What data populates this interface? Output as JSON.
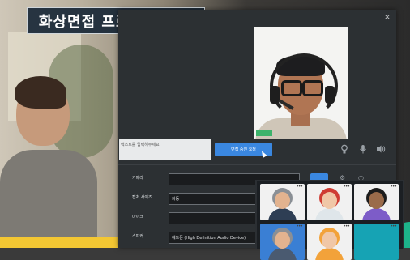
{
  "title": "화상면접 프로그램 접속",
  "dialog": {
    "close_glyph": "×",
    "message_placeholder": "텍스트를 입력해주세요.",
    "send_button": "면접 승인 요청",
    "controls": [
      "camera-icon",
      "microphone-icon",
      "speaker-icon"
    ],
    "settings": {
      "camera_label": "카메라",
      "camera_value": "",
      "resolution_label": "캡처 사이즈",
      "resolution_value": "자동",
      "mic_label": "마이크",
      "mic_value": "",
      "speaker_label": "스피커",
      "speaker_value": "헤드폰 (High Definition Audio Device)"
    }
  },
  "colors": {
    "accent": "#3a87e0",
    "dialog_bg": "#2c3033",
    "title_bg": "#192837",
    "floor": "#f3c733",
    "badge": "#1db38b"
  },
  "participants": [
    {
      "name": "participant-man-suit",
      "bg": "#f1f1f1",
      "head": "#e3b38f",
      "hair": "#8a8f95",
      "body": "#2e3e54"
    },
    {
      "name": "participant-woman-red-hair",
      "bg": "#f1f1f1",
      "head": "#f0c7a7",
      "hair": "#cf3c33",
      "body": "#dfe6ea"
    },
    {
      "name": "participant-man-purple",
      "bg": "#f1f1f1",
      "head": "#9a6b4a",
      "hair": "#1c1c1c",
      "body": "#7d5cc8"
    },
    {
      "name": "participant-man-glasses",
      "bg": "#3a7fd4",
      "head": "#e3b38f",
      "hair": "#8a8f95",
      "body": "#4a5a70"
    },
    {
      "name": "participant-woman-orange",
      "bg": "#f1f1f1",
      "head": "#f0c7a7",
      "hair": "#f2a23a",
      "body": "#f2a23a"
    },
    {
      "name": "participant-empty",
      "bg": "#16a3b4",
      "head": "",
      "hair": "",
      "body": ""
    }
  ]
}
